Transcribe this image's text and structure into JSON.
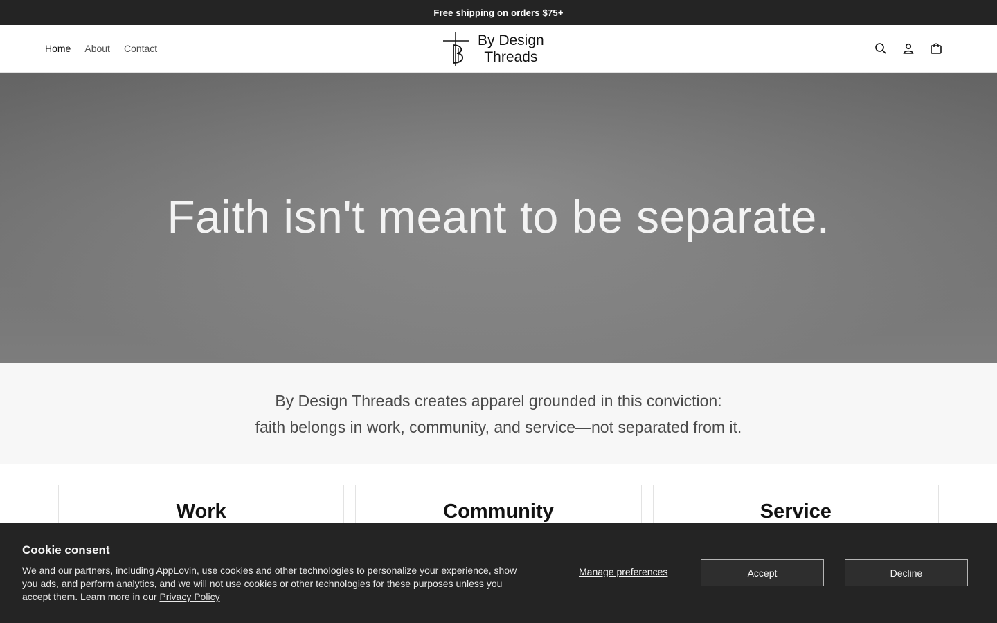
{
  "announcement": "Free shipping on orders $75+",
  "nav": [
    {
      "label": "Home"
    },
    {
      "label": "About"
    },
    {
      "label": "Contact"
    }
  ],
  "logo": {
    "line1": "By Design",
    "line2": "Threads"
  },
  "icons": [
    "search-icon",
    "account-icon",
    "cart-icon"
  ],
  "hero": {
    "heading": "Faith isn't meant to be separate."
  },
  "mission": {
    "line1": "By Design Threads creates apparel grounded in this conviction:",
    "line2": "faith belongs in work, community, and service—not separated from it."
  },
  "pillars": [
    {
      "title": "Work"
    },
    {
      "title": "Community"
    },
    {
      "title": "Service"
    }
  ],
  "cookie": {
    "title": "Cookie consent",
    "text": "We and our partners, including AppLovin, use cookies and other technologies to personalize your experience, show you ads, and perform analytics, and we will not use cookies or other technologies for these purposes unless you accept them. Learn more in our ",
    "privacy_link": "Privacy Policy",
    "manage_label": "Manage preferences",
    "accept_label": "Accept",
    "decline_label": "Decline"
  },
  "colors": {
    "dark": "#242424",
    "hero_gray": "#808080",
    "mission_bg": "#f7f7f7"
  }
}
